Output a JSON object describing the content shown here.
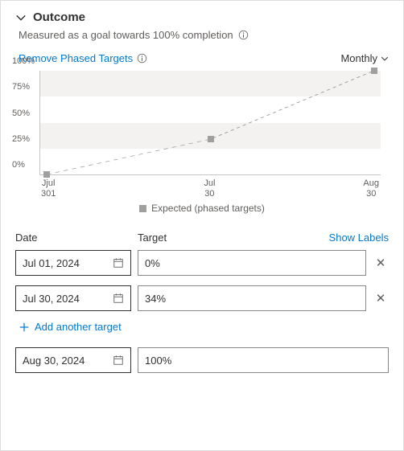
{
  "header": {
    "title": "Outcome",
    "subtitle": "Measured as a goal towards 100% completion"
  },
  "controls": {
    "remove_link": "Remove Phased Targets",
    "interval": "Monthly"
  },
  "chart_data": {
    "type": "line",
    "title": "",
    "xlabel": "",
    "ylabel": "",
    "ylim": [
      0,
      100
    ],
    "y_ticks": [
      "0%",
      "25%",
      "50%",
      "75%",
      "100%"
    ],
    "categories": [
      "Jul 01",
      "Jul 30",
      "Aug 30"
    ],
    "x_tick_labels": [
      {
        "line1": "Jjul",
        "line2": "301"
      },
      {
        "line1": "Jul",
        "line2": "30"
      },
      {
        "line1": "Aug",
        "line2": "30"
      }
    ],
    "series": [
      {
        "name": "Expected (phased targets)",
        "values": [
          0,
          34,
          100
        ]
      }
    ],
    "legend": "Expected (phased targets)"
  },
  "columns": {
    "date": "Date",
    "target": "Target",
    "show_labels": "Show Labels"
  },
  "targets": [
    {
      "date": "Jul 01, 2024",
      "value": "0%",
      "removable": true
    },
    {
      "date": "Jul 30, 2024",
      "value": "34%",
      "removable": true
    }
  ],
  "add_link": "Add another target",
  "final_target": {
    "date": "Aug 30, 2024",
    "value": "100%"
  }
}
